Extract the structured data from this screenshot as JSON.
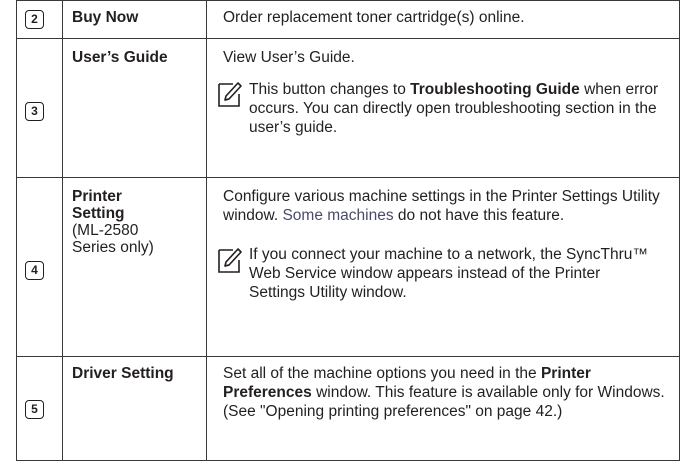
{
  "rows": [
    {
      "number": "2",
      "name": "Buy Now",
      "desc": "Order replacement toner cartridge(s) online."
    },
    {
      "number": "3",
      "name": "User’s Guide",
      "desc": "View User’s Guide.",
      "note": {
        "pre": "This button changes to ",
        "bold": "Troubleshooting Guide",
        "post": " when error occurs. You can directly open troubleshooting section in the user’s guide."
      }
    },
    {
      "number": "4",
      "name_bold": "Printer Setting",
      "name_rest": "(ML-2580 Series only)",
      "desc_pre": "Configure various machine settings in the Printer Settings Utility window. ",
      "desc_link": "Some machines",
      "desc_post": " do not have this feature.",
      "note": "If you connect your machine to a network, the SyncThru™ Web Service window appears instead of the Printer Settings Utility window."
    },
    {
      "number": "5",
      "name": "Driver Setting",
      "desc_pre": "Set all of the machine options you need in the ",
      "desc_bold": "Printer Preferences",
      "desc_post": " window. This feature is available only for Windows. (See \"Opening printing preferences\" on page 42.)"
    }
  ],
  "icons": {
    "note": "pencil-note-icon"
  }
}
